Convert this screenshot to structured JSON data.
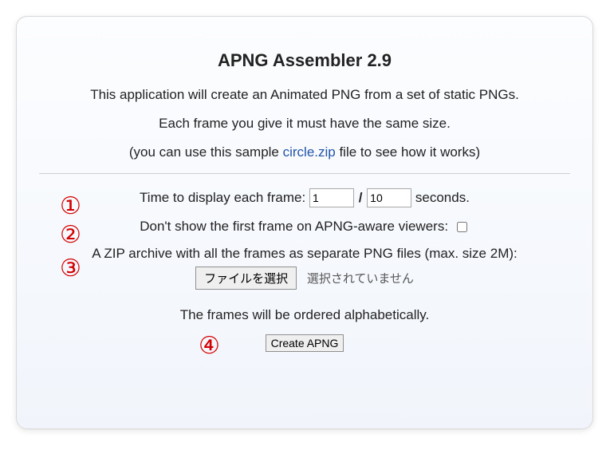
{
  "title": "APNG Assembler 2.9",
  "intro": {
    "line1": "This application will create an Animated PNG from a set of static PNGs.",
    "line2": "Each frame you give it must have the same size.",
    "line3_pre": "(you can use this sample ",
    "line3_link": "circle.zip",
    "line3_post": " file to see how it works)"
  },
  "badges": {
    "b1": "①",
    "b2": "②",
    "b3": "③",
    "b4": "④"
  },
  "frame_time": {
    "label_pre": "Time to display each frame: ",
    "num_value": "1",
    "slash": "/",
    "den_value": "10",
    "label_post": " seconds."
  },
  "skip_first": {
    "label": "Don't show the first frame on APNG-aware viewers: ",
    "checked": false
  },
  "zip": {
    "label": "A ZIP archive with all the frames as separate PNG files (max. size 2M):",
    "button": "ファイルを選択",
    "status": "選択されていません"
  },
  "order_note": "The frames will be ordered alphabetically.",
  "submit": "Create APNG"
}
